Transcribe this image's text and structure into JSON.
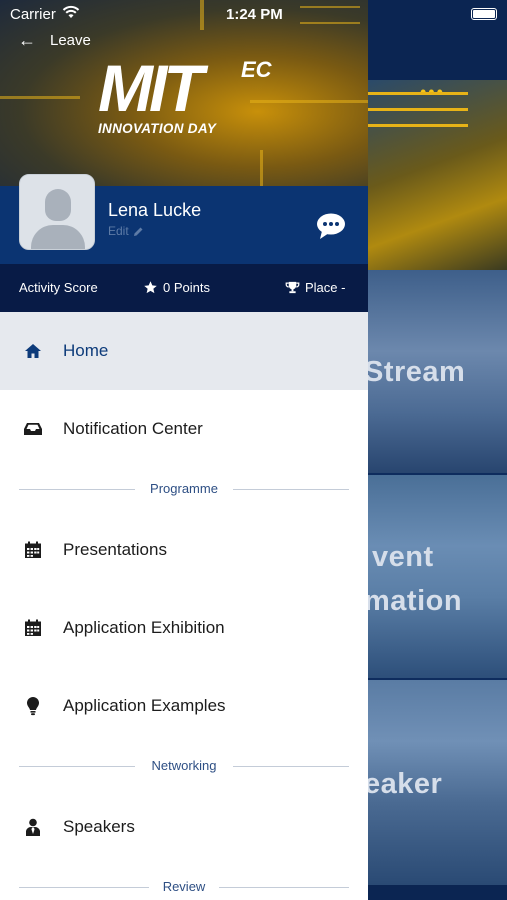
{
  "status": {
    "carrier": "Carrier",
    "time": "1:24 PM"
  },
  "header": {
    "back_label": "Leave",
    "logo_main": "MIT",
    "logo_super": "EC",
    "logo_tagline": "INNOVATION DAY"
  },
  "profile": {
    "name": "Lena Lucke",
    "edit_label": "Edit"
  },
  "score": {
    "activity_label": "Activity Score",
    "points": "0 Points",
    "place": "Place -"
  },
  "menu": {
    "home": "Home",
    "notifications": "Notification Center",
    "section_programme": "Programme",
    "presentations": "Presentations",
    "application_exhibition": "Application Exhibition",
    "application_examples": "Application Examples",
    "section_networking": "Networking",
    "speakers": "Speakers",
    "section_review": "Review"
  },
  "background": {
    "tile1": "Stream",
    "tile2_line1": "vent",
    "tile2_line2": "mation",
    "tile3": "eaker"
  },
  "colors": {
    "accent": "#0b3472",
    "scorebar": "#081b46",
    "active_row": "#e6e9ee",
    "section_text": "#2e4f84"
  }
}
